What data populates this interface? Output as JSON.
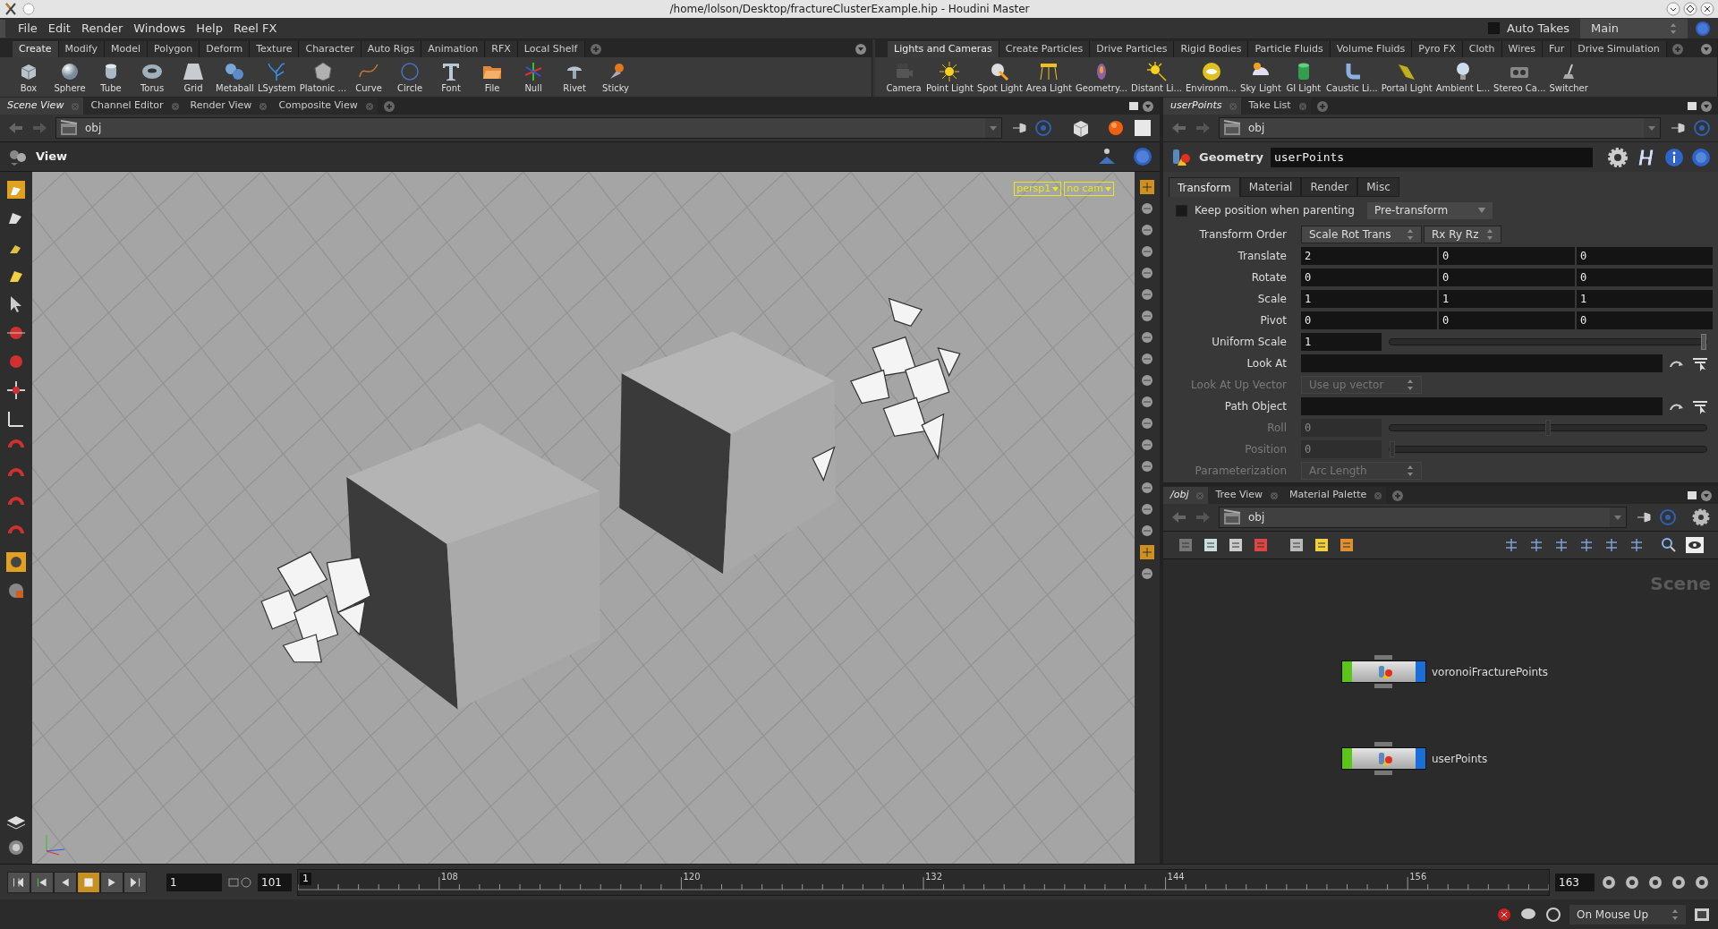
{
  "window": {
    "title": "/home/lolson/Desktop/fractureClusterExample.hip - Houdini Master"
  },
  "menu": [
    "File",
    "Edit",
    "Render",
    "Windows",
    "Help",
    "Reel FX"
  ],
  "takes": {
    "auto_takes": {
      "label": "Auto Takes",
      "checked": false
    },
    "current": "Main"
  },
  "shelf_left": {
    "tabs": [
      {
        "label": "Create",
        "selected": true
      },
      {
        "label": "Modify",
        "selected": false
      },
      {
        "label": "Model",
        "selected": false
      },
      {
        "label": "Polygon",
        "selected": false
      },
      {
        "label": "Deform",
        "selected": false
      },
      {
        "label": "Texture",
        "selected": false
      },
      {
        "label": "Character",
        "selected": false
      },
      {
        "label": "Auto Rigs",
        "selected": false
      },
      {
        "label": "Animation",
        "selected": false
      },
      {
        "label": "RFX",
        "selected": false
      },
      {
        "label": "Local Shelf",
        "selected": false
      }
    ],
    "tools": [
      "Box",
      "Sphere",
      "Tube",
      "Torus",
      "Grid",
      "Metaball",
      "LSystem",
      "Platonic ...",
      "Curve",
      "Circle",
      "Font",
      "File",
      "Null",
      "Rivet",
      "Sticky"
    ]
  },
  "shelf_right": {
    "tabs": [
      {
        "label": "Lights and Cameras",
        "selected": true
      },
      {
        "label": "Create Particles",
        "selected": false
      },
      {
        "label": "Drive Particles",
        "selected": false
      },
      {
        "label": "Rigid Bodies",
        "selected": false
      },
      {
        "label": "Particle Fluids",
        "selected": false
      },
      {
        "label": "Volume Fluids",
        "selected": false
      },
      {
        "label": "Pyro FX",
        "selected": false
      },
      {
        "label": "Cloth",
        "selected": false
      },
      {
        "label": "Wires",
        "selected": false
      },
      {
        "label": "Fur",
        "selected": false
      },
      {
        "label": "Drive Simulation",
        "selected": false
      }
    ],
    "tools": [
      "Camera",
      "Point Light",
      "Spot Light",
      "Area Light",
      "Geometry...",
      "Distant Li...",
      "Environm...",
      "Sky Light",
      "GI Light",
      "Caustic Li...",
      "Portal Light",
      "Ambient L...",
      "Stereo Ca...",
      "Switcher"
    ]
  },
  "scene_pane": {
    "tabs": [
      {
        "label": "Scene View",
        "selected": true
      },
      {
        "label": "Channel Editor",
        "selected": false
      },
      {
        "label": "Render View",
        "selected": false
      },
      {
        "label": "Composite View",
        "selected": false
      }
    ],
    "path": "obj",
    "view_title": "View",
    "camera_menus": [
      "persp1",
      "no cam"
    ]
  },
  "parameters_pane": {
    "tabs": [
      {
        "label": "userPoints",
        "selected": true
      },
      {
        "label": "Take List",
        "selected": false
      }
    ],
    "path": "obj",
    "node_type": "Geometry",
    "node_name": "userPoints",
    "param_tabs": [
      {
        "label": "Transform",
        "selected": true
      },
      {
        "label": "Material",
        "selected": false
      },
      {
        "label": "Render",
        "selected": false
      },
      {
        "label": "Misc",
        "selected": false
      }
    ],
    "keep_position": {
      "label": "Keep position when parenting",
      "checked": false,
      "menu": "Pre-transform"
    },
    "rows": [
      {
        "kind": "menus",
        "label": "Transform Order",
        "values": [
          "Scale Rot Trans",
          "Rx Ry Rz"
        ],
        "disabled": false
      },
      {
        "kind": "vector",
        "label": "Translate",
        "values": [
          "2",
          "0",
          "0"
        ],
        "disabled": false
      },
      {
        "kind": "vector",
        "label": "Rotate",
        "values": [
          "0",
          "0",
          "0"
        ],
        "disabled": false
      },
      {
        "kind": "vector",
        "label": "Scale",
        "values": [
          "1",
          "1",
          "1"
        ],
        "disabled": false
      },
      {
        "kind": "vector",
        "label": "Pivot",
        "values": [
          "0",
          "0",
          "0"
        ],
        "disabled": false
      },
      {
        "kind": "slider",
        "label": "Uniform Scale",
        "value": "1",
        "level": 1,
        "disabled": false
      },
      {
        "kind": "path",
        "label": "Look At",
        "disabled": false
      },
      {
        "kind": "menus",
        "label": "Look At Up Vector",
        "values": [
          "Use up vector"
        ],
        "disabled": true
      },
      {
        "kind": "path",
        "label": "Path Object",
        "disabled": false
      },
      {
        "kind": "slider",
        "label": "Roll",
        "value": "0",
        "level": 0.5,
        "disabled": true
      },
      {
        "kind": "slider",
        "label": "Position",
        "value": "0",
        "level": 0,
        "disabled": true
      },
      {
        "kind": "menus",
        "label": "Parameterization",
        "values": [
          "Arc Length"
        ],
        "disabled": true
      }
    ]
  },
  "network_pane": {
    "tabs": [
      {
        "label": "/obj",
        "selected": true
      },
      {
        "label": "Tree View",
        "selected": false
      },
      {
        "label": "Material Palette",
        "selected": false
      }
    ],
    "path": "obj",
    "context_label": "Scene",
    "nodes": [
      {
        "name": "voronoiFracturePoints"
      },
      {
        "name": "userPoints"
      }
    ]
  },
  "timeline": {
    "current_frame": "1",
    "start_frame": "101",
    "marker": "1",
    "tick_labels": [
      "108",
      "120",
      "132",
      "144",
      "156"
    ],
    "end_frame": "163"
  },
  "status_bar": {
    "update_mode": "On Mouse Up"
  }
}
